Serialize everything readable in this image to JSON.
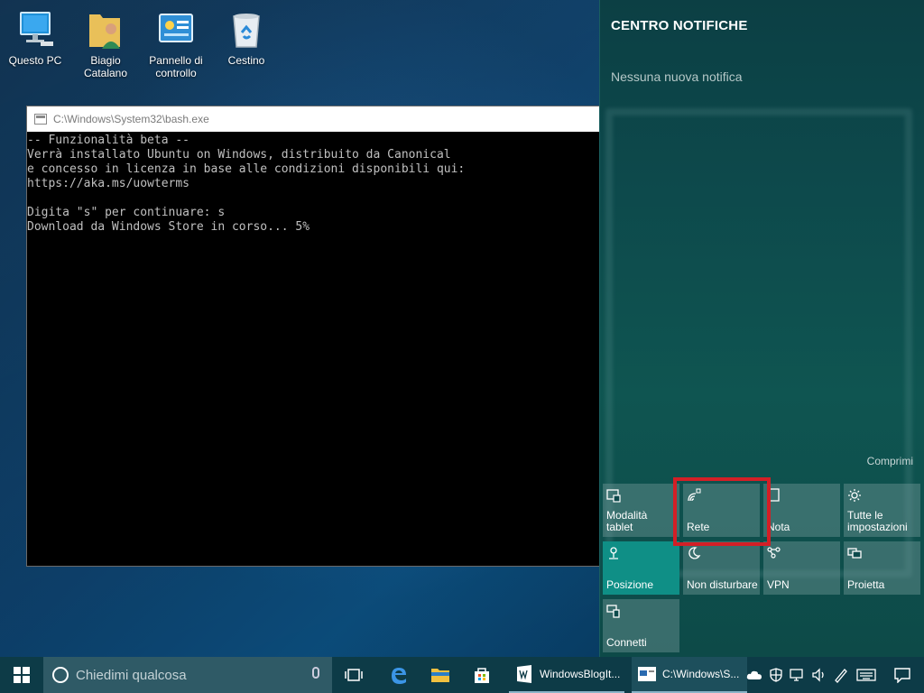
{
  "desktop": {
    "icons": [
      {
        "label_line1": "Questo PC",
        "label_line2": "",
        "icon": "computer-icon"
      },
      {
        "label_line1": "Biagio",
        "label_line2": "Catalano",
        "icon": "user-folder-icon"
      },
      {
        "label_line1": "Pannello di",
        "label_line2": "controllo",
        "icon": "control-panel-icon"
      },
      {
        "label_line1": "Cestino",
        "label_line2": "",
        "icon": "recycle-bin-icon"
      }
    ]
  },
  "console": {
    "title": "C:\\Windows\\System32\\bash.exe",
    "lines": [
      "-- Funzionalità beta --",
      "Verrà installato Ubuntu on Windows, distribuito da Canonical",
      "e concesso in licenza in base alle condizioni disponibili qui:",
      "https://aka.ms/uowterms",
      "",
      "Digita \"s\" per continuare: s",
      "Download da Windows Store in corso... 5%"
    ]
  },
  "action_center": {
    "title": "CENTRO NOTIFICHE",
    "empty_message": "Nessuna nuova notifica",
    "collapse_label": "Comprimi",
    "tiles": [
      {
        "label1": "Modalità",
        "label2": "tablet",
        "icon": "tablet-mode-icon",
        "active": false
      },
      {
        "label1": "Rete",
        "label2": "",
        "icon": "network-icon",
        "active": false
      },
      {
        "label1": "Nota",
        "label2": "",
        "icon": "note-icon",
        "active": false
      },
      {
        "label1": "Tutte le",
        "label2": "impostazioni",
        "icon": "settings-gear-icon",
        "active": false
      },
      {
        "label1": "Posizione",
        "label2": "",
        "icon": "location-icon",
        "active": true
      },
      {
        "label1": "Non disturbare",
        "label2": "",
        "icon": "moon-icon",
        "active": false
      },
      {
        "label1": "VPN",
        "label2": "",
        "icon": "vpn-icon",
        "active": false
      },
      {
        "label1": "Proietta",
        "label2": "",
        "icon": "project-icon",
        "active": false
      },
      {
        "label1": "Connetti",
        "label2": "",
        "icon": "connect-icon",
        "active": false
      }
    ]
  },
  "taskbar": {
    "search_placeholder": "Chiedimi qualcosa",
    "apps": [
      {
        "label": "WindowsBlogIt...",
        "icon": "word-icon"
      },
      {
        "label": "C:\\Windows\\S...",
        "icon": "console-icon"
      }
    ]
  },
  "colors": {
    "accent_active_tile": "#0f8f86",
    "highlight_box": "#d31f26",
    "taskbar": "#0d3b47"
  }
}
